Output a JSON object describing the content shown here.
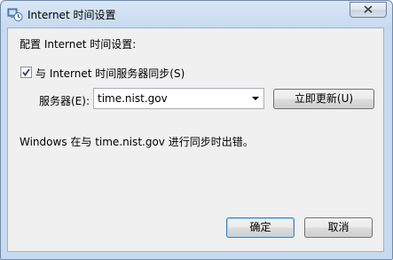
{
  "window": {
    "title": "Internet 时间设置"
  },
  "content": {
    "configure_label": "配置 Internet 时间设置:",
    "sync_checkbox_label": "与 Internet 时间服务器同步(S)",
    "sync_checked": true,
    "server_label": "服务器(E):",
    "server_value": "time.nist.gov",
    "update_now_label": "立即更新(U)",
    "status_message": "Windows 在与 time.nist.gov 进行同步时出错。"
  },
  "buttons": {
    "ok_label": "确定",
    "cancel_label": "取消"
  },
  "colors": {
    "title_gradient_top": "#d9e7f6",
    "client_background": "#f0f0f0"
  }
}
